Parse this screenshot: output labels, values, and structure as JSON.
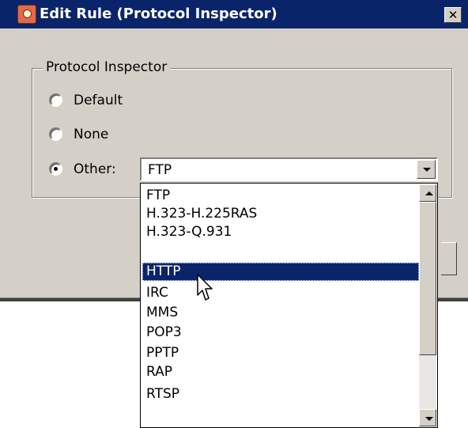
{
  "window": {
    "title": "Edit Rule (Protocol Inspector)",
    "close_symbol": "✕"
  },
  "group": {
    "label": "Protocol Inspector"
  },
  "radios": [
    {
      "label": "Default",
      "checked": false
    },
    {
      "label": "None",
      "checked": false
    },
    {
      "label": "Other:",
      "checked": true
    }
  ],
  "combo": {
    "value": "FTP",
    "options": [
      "FTP",
      "H.323-H.225RAS",
      "H.323-Q.931",
      "HTTP",
      "IRC",
      "MMS",
      "POP3",
      "PPTP",
      "RAP",
      "RTSP"
    ],
    "highlighted": "HTTP"
  },
  "colors": {
    "titlebar": "#0a246a",
    "window_face": "#d4d0c8",
    "selection": "#0a246a"
  },
  "icons": {
    "app": "protocol-inspector-icon",
    "close": "close-icon",
    "dropdown": "chevron-down-icon",
    "scroll_up": "scroll-up-icon",
    "scroll_down": "scroll-down-icon",
    "cursor": "mouse-pointer-icon"
  }
}
